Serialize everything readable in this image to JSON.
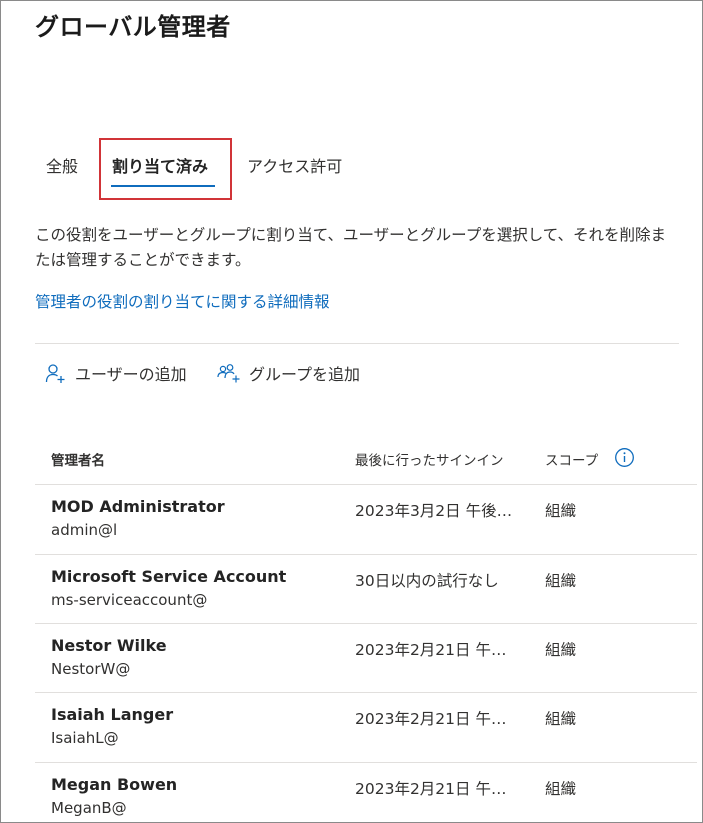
{
  "page": {
    "title": "グローバル管理者"
  },
  "tabs": [
    {
      "label": "全般"
    },
    {
      "label": "割り当て済み"
    },
    {
      "label": "アクセス許可"
    }
  ],
  "description": "この役割をユーザーとグループに割り当て、ユーザーとグループを選択して、それを削除または管理することができます。",
  "learn_more_link": "管理者の役割の割り当てに関する詳細情報",
  "commands": {
    "add_user": "ユーザーの追加",
    "add_group": "グループを追加"
  },
  "table": {
    "headers": {
      "name": "管理者名",
      "last_signin": "最後に行ったサインイン",
      "scope": "スコープ"
    },
    "rows": [
      {
        "name": "MOD Administrator",
        "email": "admin@l",
        "last_signin": "2023年3月2日 午後…",
        "scope": "組織"
      },
      {
        "name": "Microsoft Service Account",
        "email": "ms-serviceaccount@",
        "last_signin": "30日以内の試行なし",
        "scope": "組織"
      },
      {
        "name": "Nestor Wilke",
        "email": "NestorW@",
        "last_signin": "2023年2月21日 午…",
        "scope": "組織"
      },
      {
        "name": "Isaiah Langer",
        "email": "IsaiahL@",
        "last_signin": "2023年2月21日 午…",
        "scope": "組織"
      },
      {
        "name": "Megan Bowen",
        "email": "MeganB@",
        "last_signin": "2023年2月21日 午…",
        "scope": "組織"
      }
    ]
  },
  "colors": {
    "accent": "#0f6cbd",
    "highlight_border": "#d13438"
  }
}
